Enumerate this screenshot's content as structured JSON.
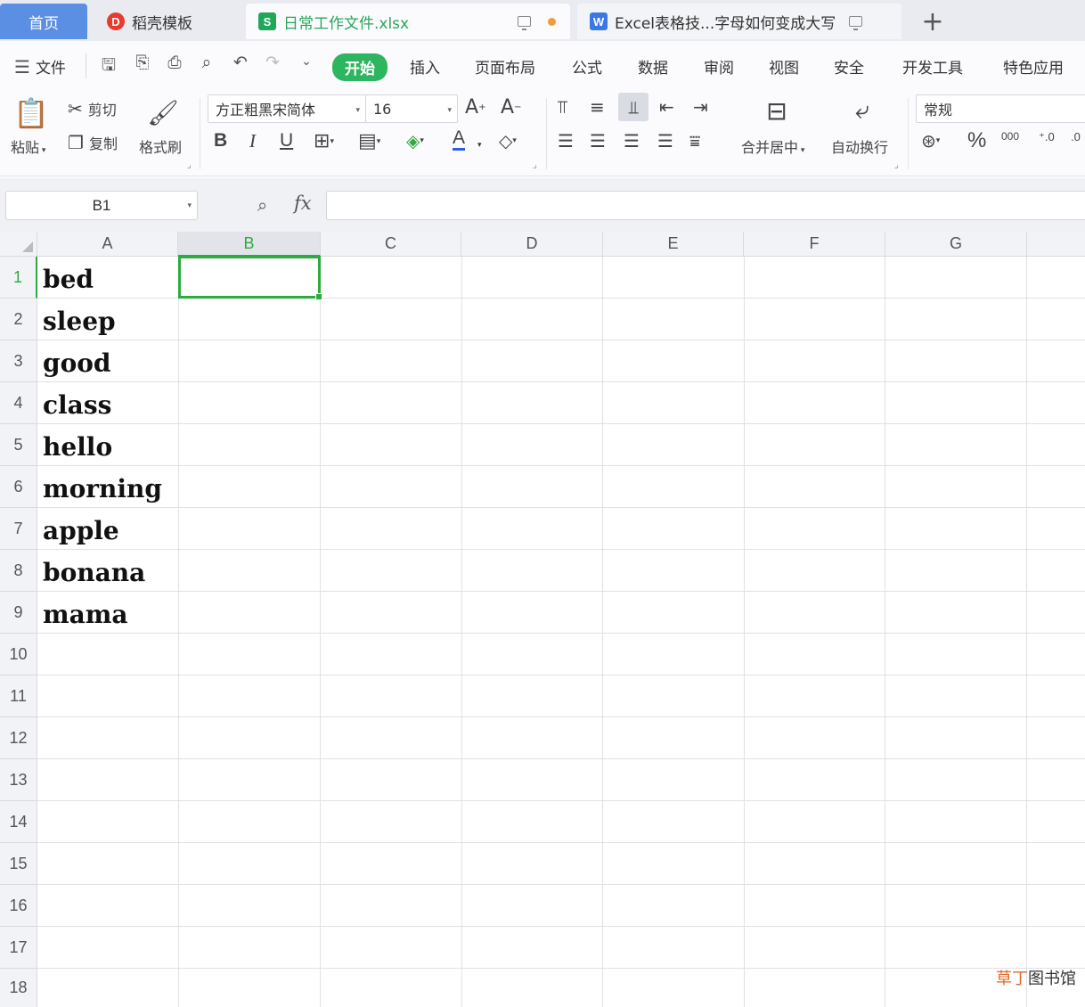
{
  "tabs": {
    "home": "首页",
    "templates": "稻壳模板",
    "workbook": "日常工作文件.xlsx",
    "document": "Excel表格技...字母如何变成大写",
    "add": "+"
  },
  "menu": {
    "file": "文件",
    "items": [
      "开始",
      "插入",
      "页面布局",
      "公式",
      "数据",
      "审阅",
      "视图",
      "安全",
      "开发工具",
      "特色应用"
    ]
  },
  "ribbon": {
    "paste": "粘贴",
    "cut": "剪切",
    "copy": "复制",
    "format_painter": "格式刷",
    "font_name": "方正粗黑宋简体",
    "font_size": "16",
    "merge_center": "合并居中",
    "wrap_text": "自动换行",
    "number_format": "常规",
    "percent": "%",
    "thousands": "000"
  },
  "formula_bar": {
    "cell_ref": "B1",
    "fx": "fx",
    "value": ""
  },
  "sheet": {
    "columns": [
      "A",
      "B",
      "C",
      "D",
      "E",
      "F",
      "G"
    ],
    "rows": [
      "1",
      "2",
      "3",
      "4",
      "5",
      "6",
      "7",
      "8",
      "9",
      "10",
      "11",
      "12",
      "13",
      "14",
      "15",
      "16",
      "17",
      "18"
    ],
    "column_a": [
      "bed",
      "sleep",
      "good",
      "class",
      "hello",
      "morning",
      "apple",
      "bonana",
      "mama"
    ],
    "selected_cell": "B1"
  },
  "watermark": {
    "accent": "草丁",
    "rest": "图书馆"
  },
  "colors": {
    "accent_green": "#2eb55f",
    "home_tab_blue": "#5b8fe3",
    "selection_green": "#2eaa3e"
  }
}
